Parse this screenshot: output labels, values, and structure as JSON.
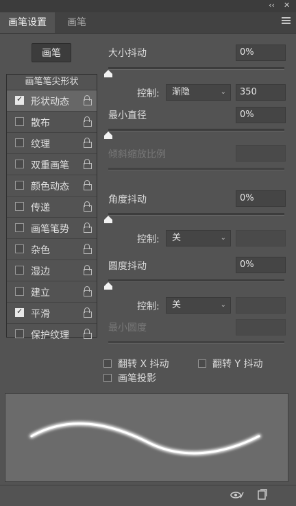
{
  "window_controls": {
    "collapse": "‹‹",
    "close": "✕"
  },
  "tabs": [
    {
      "label": "画笔设置",
      "active": true
    },
    {
      "label": "画笔",
      "active": false
    }
  ],
  "brushes_button": "画笔",
  "list": {
    "header": "画笔笔尖形状",
    "items": [
      {
        "label": "形状动态",
        "checked": true,
        "selected": true
      },
      {
        "label": "散布",
        "checked": false
      },
      {
        "label": "纹理",
        "checked": false
      },
      {
        "label": "双重画笔",
        "checked": false
      },
      {
        "label": "颜色动态",
        "checked": false
      },
      {
        "label": "传递",
        "checked": false
      },
      {
        "label": "画笔笔势",
        "checked": false
      },
      {
        "label": "杂色",
        "checked": false
      },
      {
        "label": "湿边",
        "checked": false
      },
      {
        "label": "建立",
        "checked": false
      },
      {
        "label": "平滑",
        "checked": true
      },
      {
        "label": "保护纹理",
        "checked": false
      }
    ]
  },
  "settings": {
    "size_jitter": {
      "label": "大小抖动",
      "value": "0%"
    },
    "size_control": {
      "label": "控制:",
      "option": "渐隐",
      "value": "350"
    },
    "min_diameter": {
      "label": "最小直径",
      "value": "0%"
    },
    "tilt_scale": {
      "label": "倾斜缩放比例",
      "value": ""
    },
    "angle_jitter": {
      "label": "角度抖动",
      "value": "0%"
    },
    "angle_control": {
      "label": "控制:",
      "option": "关"
    },
    "roundness_jitter": {
      "label": "圆度抖动",
      "value": "0%"
    },
    "roundness_control": {
      "label": "控制:",
      "option": "关"
    },
    "min_roundness": {
      "label": "最小圆度",
      "value": ""
    }
  },
  "options": {
    "flip_x": "翻转 X 抖动",
    "flip_y": "翻转 Y 抖动",
    "projection": "画笔投影"
  },
  "colors": {
    "panel": "#535353",
    "preview": "#6b6b6b",
    "stroke": "#ffffff"
  }
}
